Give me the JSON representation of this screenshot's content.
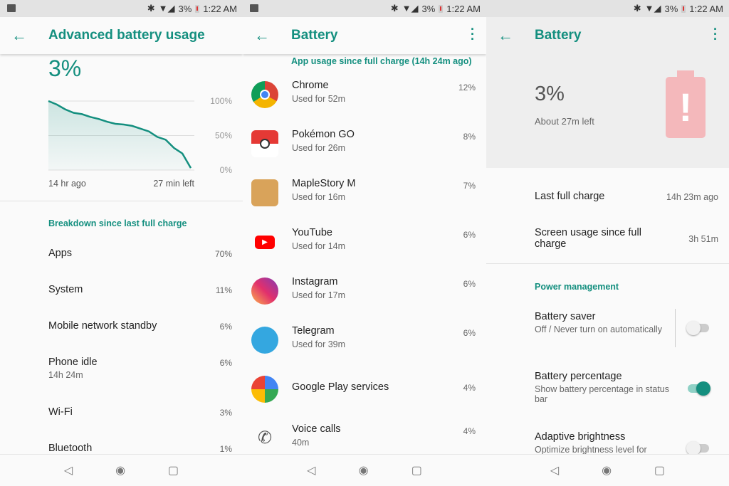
{
  "status": {
    "battery": "3%",
    "time": "1:22 AM"
  },
  "advanced": {
    "title": "Advanced battery usage",
    "level": "3%",
    "chart_data": {
      "type": "area",
      "ylim": [
        0,
        100
      ],
      "y_ticks": [
        "100%",
        "50%",
        "0%"
      ],
      "x_labels": [
        "14 hr ago",
        "27 min left"
      ],
      "grid": true,
      "color": "#148f7f",
      "values": [
        100,
        95,
        88,
        83,
        81,
        77,
        74,
        70,
        67,
        66,
        64,
        60,
        56,
        48,
        44,
        32,
        24,
        3
      ]
    },
    "section": "Breakdown since last full charge",
    "items": [
      {
        "label": "Apps",
        "value": "70%"
      },
      {
        "label": "System",
        "value": "11%"
      },
      {
        "label": "Mobile network standby",
        "value": "6%"
      },
      {
        "label": "Phone idle",
        "sub": "14h 24m",
        "value": "6%"
      },
      {
        "label": "Wi-Fi",
        "value": "3%"
      },
      {
        "label": "Bluetooth",
        "value": "1%"
      }
    ]
  },
  "battery_apps": {
    "title": "Battery",
    "section": "App usage since full charge (14h 24m ago)",
    "apps": [
      {
        "name": "Chrome",
        "usage": "Used for 52m",
        "pct": "12%",
        "icon": "chrome-icon"
      },
      {
        "name": "Pokémon GO",
        "usage": "Used for 26m",
        "pct": "8%",
        "icon": "pokemon-go-icon"
      },
      {
        "name": "MapleStory M",
        "usage": "Used for 16m",
        "pct": "7%",
        "icon": "maplestory-icon"
      },
      {
        "name": "YouTube",
        "usage": "Used for 14m",
        "pct": "6%",
        "icon": "youtube-icon"
      },
      {
        "name": "Instagram",
        "usage": "Used for 17m",
        "pct": "6%",
        "icon": "instagram-icon"
      },
      {
        "name": "Telegram",
        "usage": "Used for 39m",
        "pct": "6%",
        "icon": "telegram-icon"
      },
      {
        "name": "Google Play services",
        "usage": "",
        "pct": "4%",
        "icon": "play-services-icon"
      },
      {
        "name": "Voice calls",
        "usage": "40m",
        "pct": "4%",
        "icon": "phone-icon"
      }
    ]
  },
  "battery_main": {
    "title": "Battery",
    "level": "3%",
    "remaining": "About 27m left",
    "alert_color": "#f4b8bb",
    "last_full_label": "Last full charge",
    "last_full_value": "14h 23m ago",
    "screen_label": "Screen usage since full charge",
    "screen_value": "3h 51m",
    "section": "Power management",
    "saver": {
      "label": "Battery saver",
      "sub": "Off / Never turn on automatically",
      "on": false
    },
    "percentage": {
      "label": "Battery percentage",
      "sub": "Show battery percentage in status bar",
      "on": true
    },
    "adaptive": {
      "label": "Adaptive brightness",
      "sub": "Optimize brightness level for",
      "on": false
    }
  }
}
